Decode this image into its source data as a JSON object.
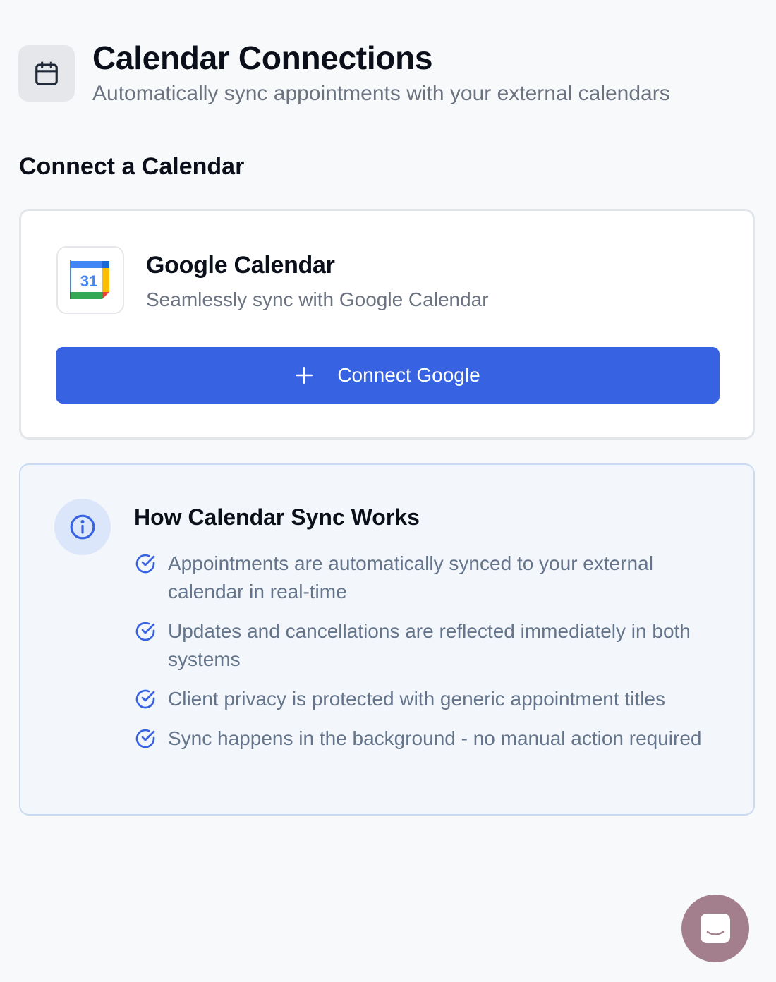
{
  "header": {
    "icon": "calendar-icon",
    "title": "Calendar Connections",
    "subtitle": "Automatically sync appointments with your external calendars"
  },
  "connect_section": {
    "title": "Connect a Calendar",
    "provider": {
      "logo": "google-calendar-logo",
      "logo_day": "31",
      "name": "Google Calendar",
      "description": "Seamlessly sync with Google Calendar",
      "button_icon": "plus-icon",
      "button_label": "Connect Google"
    }
  },
  "info": {
    "icon": "info-icon",
    "title": "How Calendar Sync Works",
    "item_icon": "check-circle-icon",
    "items": [
      "Appointments are automatically synced to your external calendar in real-time",
      "Updates and cancellations are reflected immediately in both systems",
      "Client privacy is protected with generic appointment titles",
      "Sync happens in the background - no manual action required"
    ]
  },
  "chat_widget": {
    "icon": "chat-icon"
  },
  "colors": {
    "page_background": "#f8f9fb",
    "primary": "#3763e3",
    "info_background": "#f3f6fb",
    "info_border": "#c9daf3",
    "chat_button": "#a37f8e",
    "muted_text": "#6b7280"
  }
}
